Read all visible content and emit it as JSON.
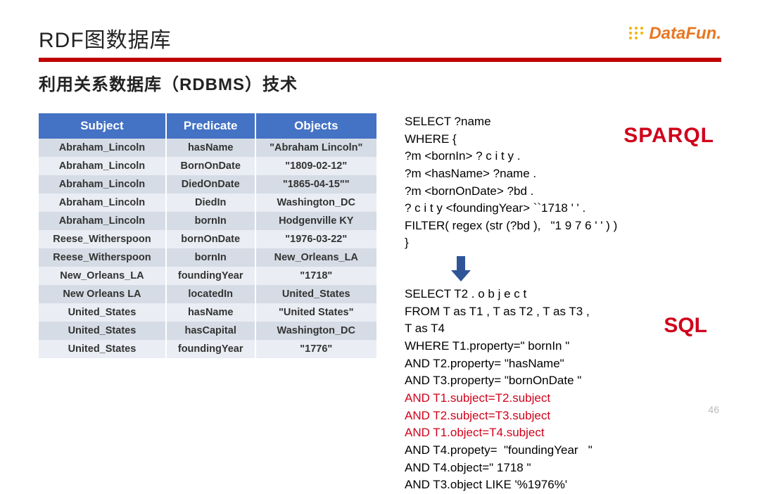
{
  "title": "RDF图数据库",
  "subtitle": "利用关系数据库（RDBMS）技术",
  "logo_text": "DataFun.",
  "page_number": "46",
  "table": {
    "headers": [
      "Subject",
      "Predicate",
      "Objects"
    ],
    "rows": [
      [
        "Abraham_Lincoln",
        "hasName",
        "\"Abraham Lincoln\""
      ],
      [
        "Abraham_Lincoln",
        "BornOnDate",
        "\"1809-02-12\""
      ],
      [
        "Abraham_Lincoln",
        "DiedOnDate",
        "\"1865-04-15\"\""
      ],
      [
        "Abraham_Lincoln",
        "DiedIn",
        "Washington_DC"
      ],
      [
        "Abraham_Lincoln",
        "bornIn",
        "Hodgenville KY"
      ],
      [
        "Reese_Witherspoon",
        "bornOnDate",
        "\"1976-03-22\""
      ],
      [
        "Reese_Witherspoon",
        "bornIn",
        "New_Orleans_LA"
      ],
      [
        "New_Orleans_LA",
        "foundingYear",
        "\"1718\""
      ],
      [
        "New Orleans LA",
        "locatedIn",
        "United_States"
      ],
      [
        "United_States",
        "hasName",
        "\"United States\""
      ],
      [
        "United_States",
        "hasCapital",
        "Washington_DC"
      ],
      [
        "United_States",
        "foundingYear",
        "\"1776\""
      ]
    ]
  },
  "sparql_label": "SPARQL",
  "sql_label": "SQL",
  "sparql_lines": [
    "SELECT ?name",
    "WHERE {",
    "?m <bornIn> ? c i t y .",
    "?m <hasName> ?name .",
    "?m <bornOnDate> ?bd .",
    "? c i t y <foundingYear> ``1718 ' ' .",
    "FILTER( regex (str (?bd ),   \"1 9 7 6 ' ' ) )",
    "}"
  ],
  "sql_lines": [
    {
      "t": "SELECT T2 . o b j e c t",
      "red": false
    },
    {
      "t": "FROM T as T1 , T as T2 , T as T3 ,",
      "red": false
    },
    {
      "t": "T as T4",
      "red": false
    },
    {
      "t": "WHERE T1.property=\" bornIn \"",
      "red": false
    },
    {
      "t": "AND T2.property= \"hasName\"",
      "red": false
    },
    {
      "t": "AND T3.property= \"bornOnDate \"",
      "red": false
    },
    {
      "t": "AND T1.subject=T2.subject",
      "red": true
    },
    {
      "t": "AND T2.subject=T3.subject",
      "red": true
    },
    {
      "t": "AND T1.object=T4.subject",
      "red": true
    },
    {
      "t": "AND T4.propety=  \"foundingYear   \"",
      "red": false
    },
    {
      "t": "AND T4.object=\" 1718 \"",
      "red": false
    },
    {
      "t": "AND T3.object LIKE '%1976%'",
      "red": false
    }
  ]
}
